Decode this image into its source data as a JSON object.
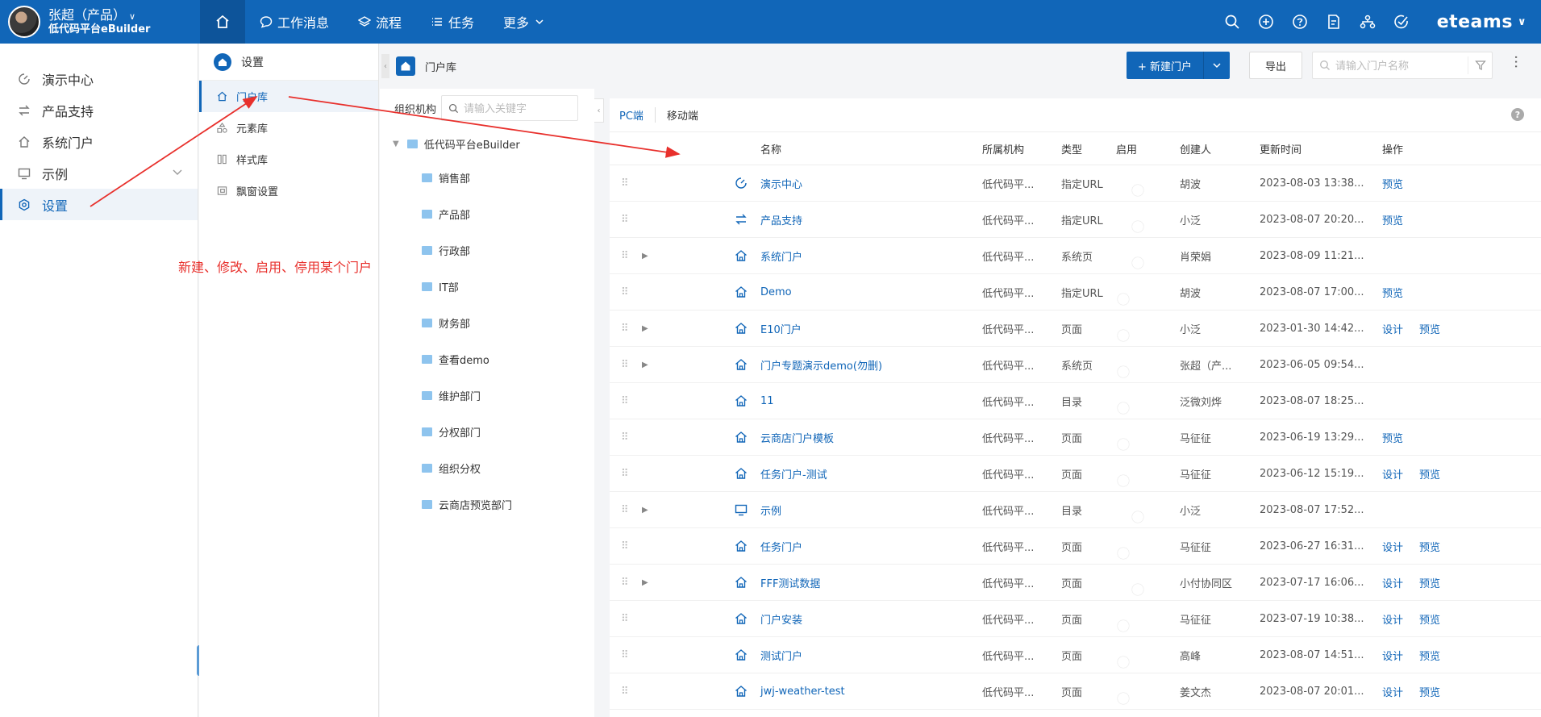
{
  "header": {
    "user_name": "张超（产品）",
    "org_name": "低代码平台eBuilder",
    "nav": [
      {
        "label": "工作消息",
        "icon": "chat-icon"
      },
      {
        "label": "流程",
        "icon": "layers-icon"
      },
      {
        "label": "任务",
        "icon": "list-icon"
      },
      {
        "label": "更多",
        "icon": "chevron-down-icon"
      }
    ],
    "brand": "eteams",
    "accent": "#1166b8"
  },
  "sidebar": {
    "items": [
      {
        "label": "演示中心",
        "icon": "dashboard-icon"
      },
      {
        "label": "产品支持",
        "icon": "arrows-icon"
      },
      {
        "label": "系统门户",
        "icon": "home-icon"
      },
      {
        "label": "示例",
        "icon": "monitor-icon"
      },
      {
        "label": "设置",
        "icon": "settings-icon",
        "active": true
      }
    ]
  },
  "settings_panel": {
    "title": "设置",
    "items": [
      {
        "label": "门户库",
        "icon": "home-icon",
        "active": true
      },
      {
        "label": "元素库",
        "icon": "elements-icon"
      },
      {
        "label": "样式库",
        "icon": "style-icon"
      },
      {
        "label": "飘窗设置",
        "icon": "window-icon"
      }
    ]
  },
  "toolbar": {
    "breadcrumb": "门户库",
    "new_button": "+ 新建门户",
    "export_button": "导出",
    "search_placeholder": "请输入门户名称"
  },
  "org_tree": {
    "label": "组织机构",
    "search_placeholder": "请输入关键字",
    "root": "低代码平台eBuilder",
    "children": [
      "销售部",
      "产品部",
      "行政部",
      "IT部",
      "财务部",
      "查看demo",
      "维护部门",
      "分权部门",
      "组织分权",
      "云商店预览部门"
    ]
  },
  "tabs": [
    "PC端",
    "移动端"
  ],
  "table": {
    "headers": {
      "name": "名称",
      "org": "所属机构",
      "type": "类型",
      "enabled": "启用",
      "creator": "创建人",
      "time": "更新时间",
      "ops": "操作"
    },
    "rows": [
      {
        "name": "演示中心",
        "icon": "dashboard-icon",
        "expandable": false,
        "org": "低代码平...",
        "type": "指定URL",
        "enabled": true,
        "creator": "胡波",
        "time": "2023-08-03 13:38...",
        "ops": [
          "预览"
        ]
      },
      {
        "name": "产品支持",
        "icon": "arrows-icon",
        "expandable": false,
        "org": "低代码平...",
        "type": "指定URL",
        "enabled": true,
        "creator": "小泛",
        "time": "2023-08-07 20:20...",
        "ops": [
          "预览"
        ]
      },
      {
        "name": "系统门户",
        "icon": "home-icon",
        "expandable": true,
        "org": "低代码平...",
        "type": "系统页",
        "enabled": true,
        "creator": "肖荣娟",
        "time": "2023-08-09 11:21...",
        "ops": []
      },
      {
        "name": "Demo",
        "icon": "home-icon",
        "expandable": false,
        "org": "低代码平...",
        "type": "指定URL",
        "enabled": false,
        "creator": "胡波",
        "time": "2023-08-07 17:00...",
        "ops": [
          "预览"
        ]
      },
      {
        "name": "E10门户",
        "icon": "home-icon",
        "expandable": true,
        "org": "低代码平...",
        "type": "页面",
        "enabled": false,
        "creator": "小泛",
        "time": "2023-01-30 14:42...",
        "ops": [
          "设计",
          "预览"
        ]
      },
      {
        "name": "门户专题演示demo(勿删)",
        "icon": "home-icon",
        "expandable": true,
        "org": "低代码平...",
        "type": "系统页",
        "enabled": false,
        "creator": "张超（产...",
        "time": "2023-06-05 09:54...",
        "ops": []
      },
      {
        "name": "11",
        "icon": "home-icon",
        "expandable": false,
        "org": "低代码平...",
        "type": "目录",
        "enabled": false,
        "creator": "泛微刘烨",
        "time": "2023-08-07 18:25...",
        "ops": []
      },
      {
        "name": "云商店门户模板",
        "icon": "home-icon",
        "expandable": false,
        "org": "低代码平...",
        "type": "页面",
        "enabled": false,
        "creator": "马征征",
        "time": "2023-06-19 13:29...",
        "ops": [
          "预览"
        ]
      },
      {
        "name": "任务门户-测试",
        "icon": "home-icon",
        "expandable": false,
        "org": "低代码平...",
        "type": "页面",
        "enabled": false,
        "creator": "马征征",
        "time": "2023-06-12 15:19...",
        "ops": [
          "设计",
          "预览"
        ]
      },
      {
        "name": "示例",
        "icon": "monitor-icon",
        "expandable": true,
        "org": "低代码平...",
        "type": "目录",
        "enabled": true,
        "creator": "小泛",
        "time": "2023-08-07 17:52...",
        "ops": []
      },
      {
        "name": "任务门户",
        "icon": "home-icon",
        "expandable": false,
        "org": "低代码平...",
        "type": "页面",
        "enabled": false,
        "creator": "马征征",
        "time": "2023-06-27 16:31...",
        "ops": [
          "设计",
          "预览"
        ]
      },
      {
        "name": "FFF测试数据",
        "icon": "home-icon",
        "expandable": true,
        "org": "低代码平...",
        "type": "页面",
        "enabled": true,
        "creator": "小付协同区",
        "time": "2023-07-17 16:06...",
        "ops": [
          "设计",
          "预览"
        ]
      },
      {
        "name": "门户安装",
        "icon": "home-icon",
        "expandable": false,
        "org": "低代码平...",
        "type": "页面",
        "enabled": false,
        "creator": "马征征",
        "time": "2023-07-19 10:38...",
        "ops": [
          "设计",
          "预览"
        ]
      },
      {
        "name": "测试门户",
        "icon": "home-icon",
        "expandable": false,
        "org": "低代码平...",
        "type": "页面",
        "enabled": false,
        "creator": "高峰",
        "time": "2023-08-07 14:51...",
        "ops": [
          "设计",
          "预览"
        ]
      },
      {
        "name": "jwj-weather-test",
        "icon": "home-icon",
        "expandable": false,
        "org": "低代码平...",
        "type": "页面",
        "enabled": false,
        "creator": "姜文杰",
        "time": "2023-08-07 20:01...",
        "ops": [
          "设计",
          "预览"
        ]
      }
    ]
  },
  "annotation": {
    "text": "新建、修改、启用、停用某个门户",
    "color": "#e8302c"
  }
}
